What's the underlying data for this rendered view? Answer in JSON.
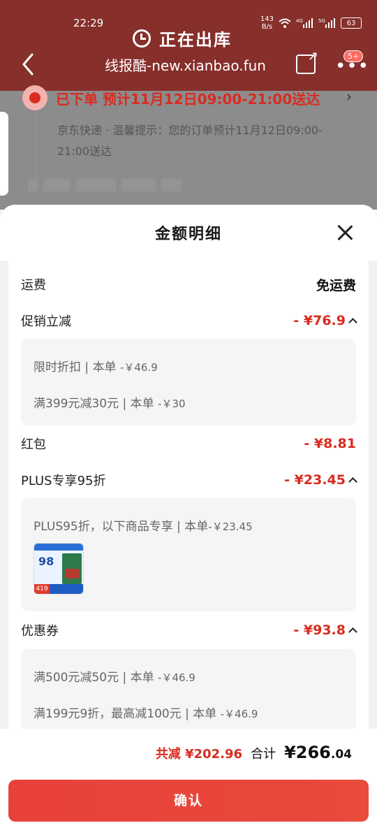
{
  "status_bar": {
    "time": "22:29",
    "net_speed_value": "143",
    "net_speed_unit": "B/s",
    "battery": "63"
  },
  "nav": {
    "title": "正在出库",
    "url": "线报酷-new.xianbao.fun",
    "badge": "5+"
  },
  "order": {
    "status_title": "已下单 预计11月12日09:00-21:00送达",
    "note": "京东快递 · 温馨提示：您的订单预计11月12日09:00-21:00送达"
  },
  "sheet": {
    "title": "金额明细",
    "shipping": {
      "label": "运费",
      "value": "免运费"
    },
    "promotion": {
      "label": "促销立减",
      "value": "- ¥76.9",
      "items": [
        {
          "text": "限时折扣 | 本单 ",
          "amount": "-￥46.9"
        },
        {
          "text": "满399元减30元 | 本单 ",
          "amount": "-￥30"
        }
      ]
    },
    "red_packet": {
      "label": "红包",
      "value": "- ¥8.81"
    },
    "plus": {
      "label": "PLUS专享95折",
      "value": "- ¥23.45",
      "item": {
        "text": "PLUS95折，以下商品专享 | 本单",
        "amount": "-￥23.45"
      },
      "product_thumb": {
        "big_text": "98",
        "tag": "419"
      }
    },
    "coupon": {
      "label": "优惠券",
      "value": "- ¥93.8",
      "items": [
        {
          "text": "满500元减50元 | 本单 ",
          "amount": "-￥46.9"
        },
        {
          "text": "满199元9折，最高减100元 | 本单 ",
          "amount": "-￥46.9"
        }
      ]
    }
  },
  "footer": {
    "reduce": "共减 ¥202.96",
    "sum_label": "合计",
    "sum_int": "¥266",
    "sum_dec": ".04",
    "confirm": "确认"
  },
  "colors": {
    "accent_red": "#d92b20",
    "button_red": "#e8413a"
  }
}
